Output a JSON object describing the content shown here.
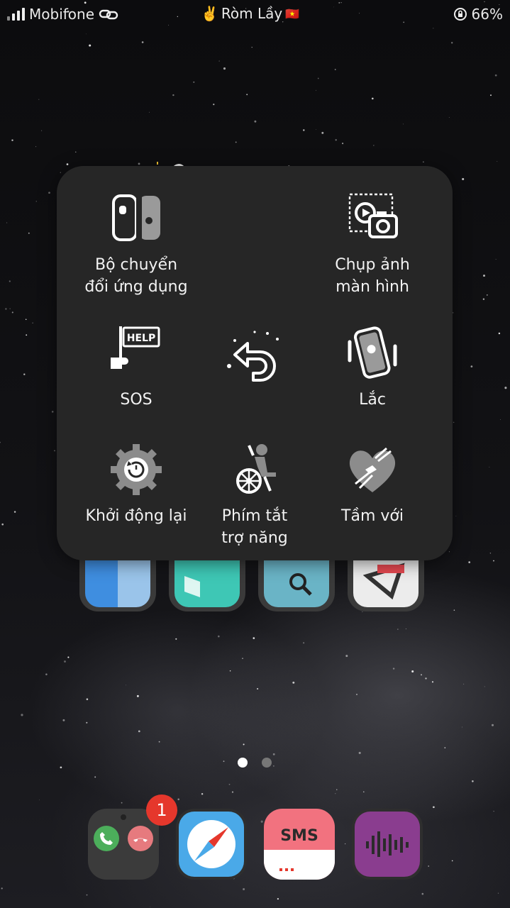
{
  "status_bar": {
    "carrier": "Mobifone",
    "center_label": "Ròm Lầy",
    "center_emoji": "✌️",
    "flag_emoji": "🇻🇳",
    "battery": "66%",
    "icons": [
      "signal-icon",
      "link-icon",
      "victory-hand-icon",
      "vietnam-flag-icon",
      "orientation-lock-icon"
    ]
  },
  "assistive_menu": {
    "items": [
      {
        "label_line1": "Bộ chuyển",
        "label_line2": "đổi ứng dụng",
        "icon": "app-switcher-icon"
      },
      {
        "label_line1": "Chụp ảnh",
        "label_line2": "màn hình",
        "icon": "screenshot-icon"
      },
      {
        "label_line1": "SOS",
        "label_line2": "",
        "icon": "help-flag-icon"
      },
      {
        "label_line1": "",
        "label_line2": "",
        "icon": "back-arrow-icon"
      },
      {
        "label_line1": "Lắc",
        "label_line2": "",
        "icon": "shake-phone-icon"
      },
      {
        "label_line1": "Khởi động lại",
        "label_line2": "",
        "icon": "restart-gear-icon"
      },
      {
        "label_line1": "Phím tắt",
        "label_line2": "trợ năng",
        "icon": "accessibility-shortcut-icon"
      },
      {
        "label_line1": "Tầm với",
        "label_line2": "",
        "icon": "reachability-heart-icon"
      }
    ]
  },
  "page_indicator": {
    "total": 2,
    "current": 1
  },
  "dock": {
    "phone_badge": "1",
    "sms_label": "SMS",
    "apps": [
      "phone-app",
      "safari-app",
      "sms-app",
      "voice-memo-app"
    ]
  },
  "colors": {
    "menu_bg": "#262626",
    "badge": "#e5372c",
    "sms_pink": "#f2727f",
    "voice_purple": "#8a3d8f",
    "safari_blue": "#4aa9e8"
  }
}
